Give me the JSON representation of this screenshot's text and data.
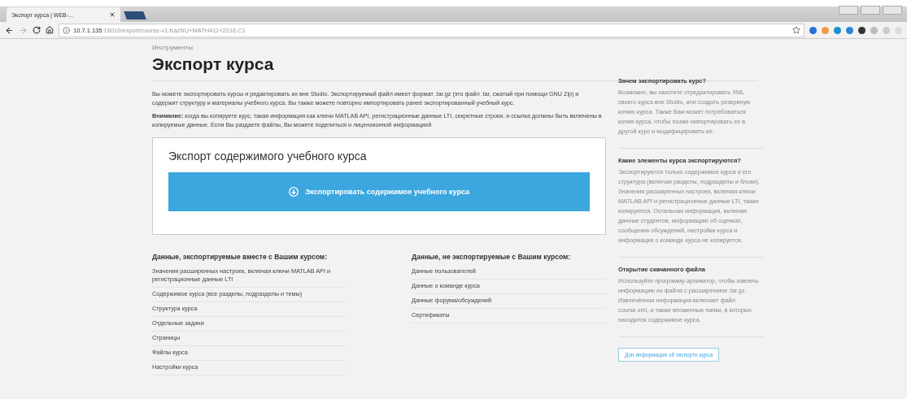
{
  "browser": {
    "tab_title": "Экспорт курса | WEB-...",
    "url_host": "10.7.1.135",
    "url_path": ":18010/export/course-v1:KazNU+MATH411+2016.C1"
  },
  "page": {
    "breadcrumb": "Инструменты",
    "title": "Экспорт курса",
    "intro": "Вы можете экспортировать курсы и редактировать их вне Studio. Экспортируемый файл имеет формат .tar.gz (это файл .tar, сжатый при помощи GNU Zip) и содержит структуру и материалы учебного курса. Вы также можете повторно импортировать ранее экспортированный учебный курс.",
    "warning": "**Внимание:** когда вы копируете курс, такая информация как ключи MATLAB API, регистрационные данные LTI, секретные строки, и ссылка должны быть включены в копируемые данные. Если Вы раздаете файлы, Вы можете поделиться и лицензионной информацией",
    "card": {
      "title": "Экспорт содержимого учебного курса",
      "button": "Экспортировать содержимое учебного курса"
    },
    "exported": {
      "heading": "Данные, экспортируемые вместе с Вашим курсом:",
      "items": [
        "Значения расширенных настроек, включая ключи MATLAB API и регистрационные данные LTI",
        "Содержимое курса (все разделы, подразделы и темы)",
        "Структура курса",
        "Отдельные задачи",
        "Страницы",
        "Файлы курса",
        "Настройки курса"
      ]
    },
    "not_exported": {
      "heading": "Данные, не экспортируемые с Вашим курсом:",
      "items": [
        "Данные пользователей",
        "Данные о команде курса",
        "Данные форума/обсуждений",
        "Сертификаты"
      ]
    }
  },
  "sidebar": {
    "sections": [
      {
        "title": "Зачем экспортировать курс?",
        "text": "Возможно, вы захотите отредактировать XML своего курса вне Studio, или создать резервную копию курса. Также Вам может потребоваться копия курса, чтобы позже импортировать ее в другой курс и модифицировать ее."
      },
      {
        "title": "Какие элементы курса экспортируются?",
        "text": "Экспортируются только содержимое курса и его структура (включая разделы, подразделы и блоки). Значения расширенных настроек, включая ключи MATLAB API и регистрационные данные LTI, также копируются. Остальная информация, включая данные студентов, информацию об оценках, сообщения обсуждений, настройки курса и информация о команде курса не копируется."
      },
      {
        "title": "Открытие скачанного файла",
        "text": "Используйте программу-архиватор, чтобы извлечь информацию из файла с расширением .tar.gz. Извлечённая информация включает файл course.xml, а также вложенные папки, в которых находится содержимое курса."
      }
    ],
    "link": "Доп информация об экспорте курса"
  }
}
